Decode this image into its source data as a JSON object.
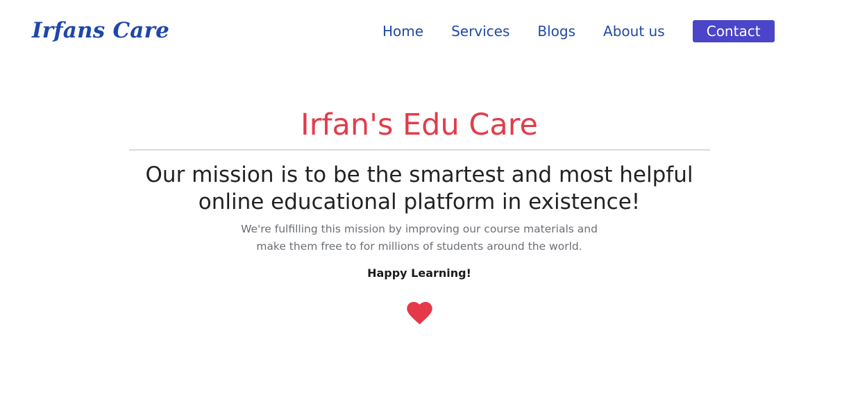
{
  "header": {
    "logo_text": "Irfans Care",
    "nav": {
      "home": "Home",
      "services": "Services",
      "blogs": "Blogs",
      "about": "About us",
      "contact": "Contact"
    }
  },
  "hero": {
    "title": "Irfan's Edu Care",
    "mission_line1": "Our mission is to be the smartest and most helpful",
    "mission_line2": "online educational platform in existence!",
    "desc_line1": "We're fulfilling this mission by improving our course materials and",
    "desc_line2": "make them free to for millions of students around the world.",
    "happy": "Happy Learning!",
    "icon": "heart-icon"
  },
  "colors": {
    "brand_blue": "#1e48a8",
    "nav_blue": "#1f4aa3",
    "contact_bg": "#4a45c9",
    "title_red": "#e23c4b",
    "heart_red": "#e5394a"
  }
}
